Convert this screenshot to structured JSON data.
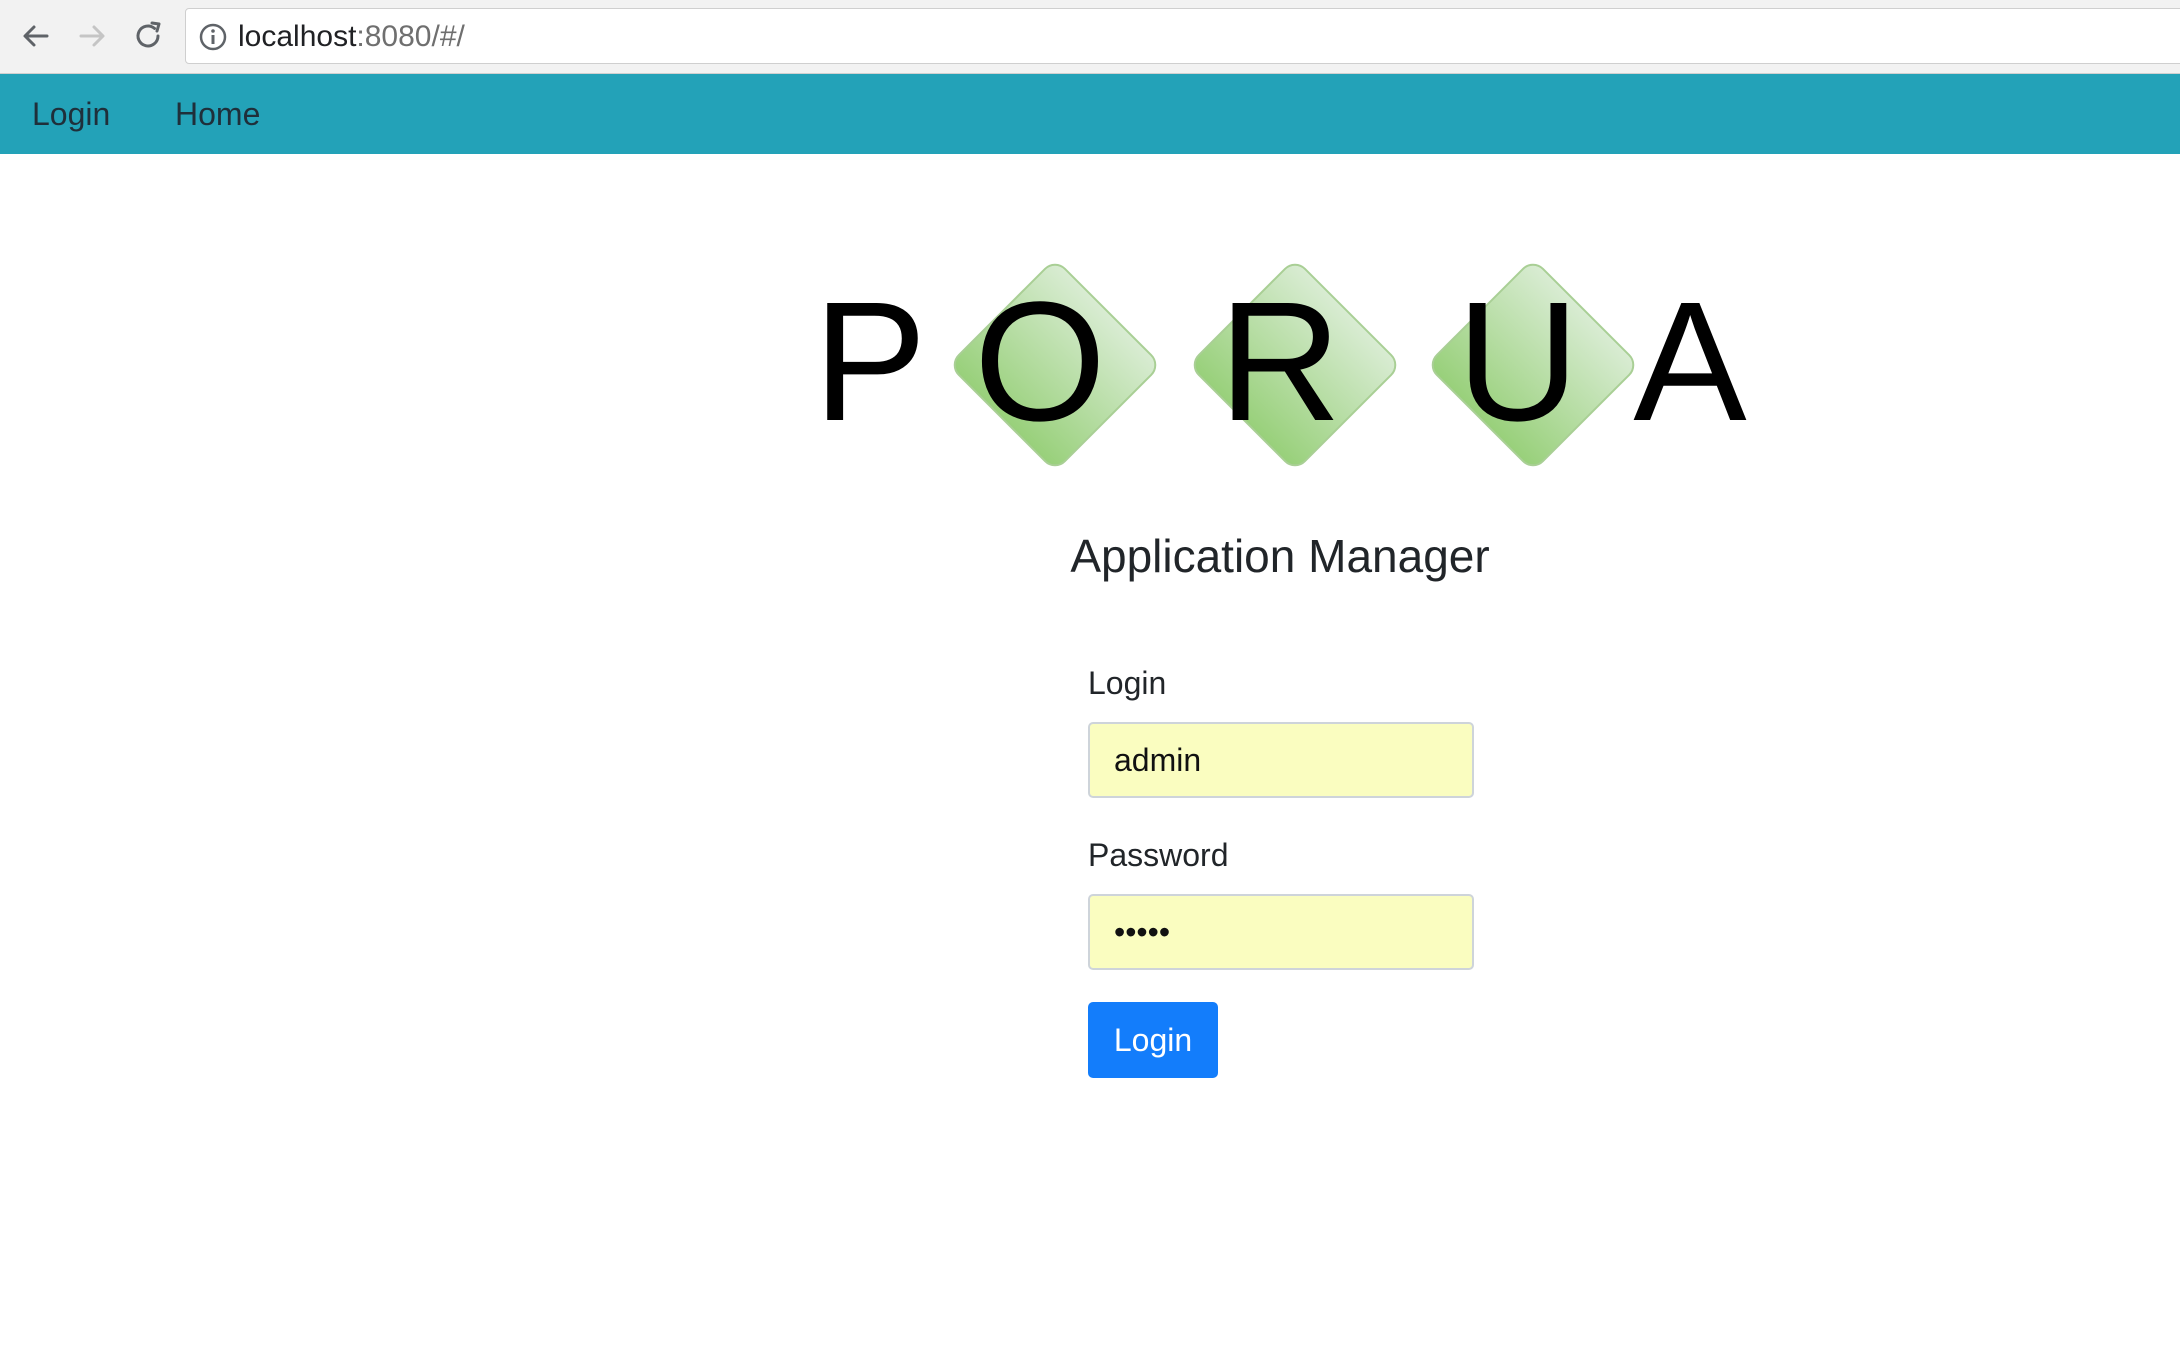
{
  "browser": {
    "url_host": "localhost",
    "url_rest": ":8080/#/"
  },
  "navbar": {
    "items": [
      {
        "label": "Login"
      },
      {
        "label": "Home"
      }
    ],
    "background_color": "#23a2b8"
  },
  "logo": {
    "letters": [
      "P",
      "O",
      "R",
      "U",
      "A"
    ],
    "diamond_color_top": "#d7ead0",
    "diamond_color_bottom": "#9bd27e"
  },
  "page": {
    "title": "Application Manager"
  },
  "form": {
    "login_label": "Login",
    "login_value": "admin",
    "password_label": "Password",
    "password_value": "admin",
    "submit_label": "Login",
    "input_background": "#fafdc0",
    "submit_color": "#137dfb"
  }
}
